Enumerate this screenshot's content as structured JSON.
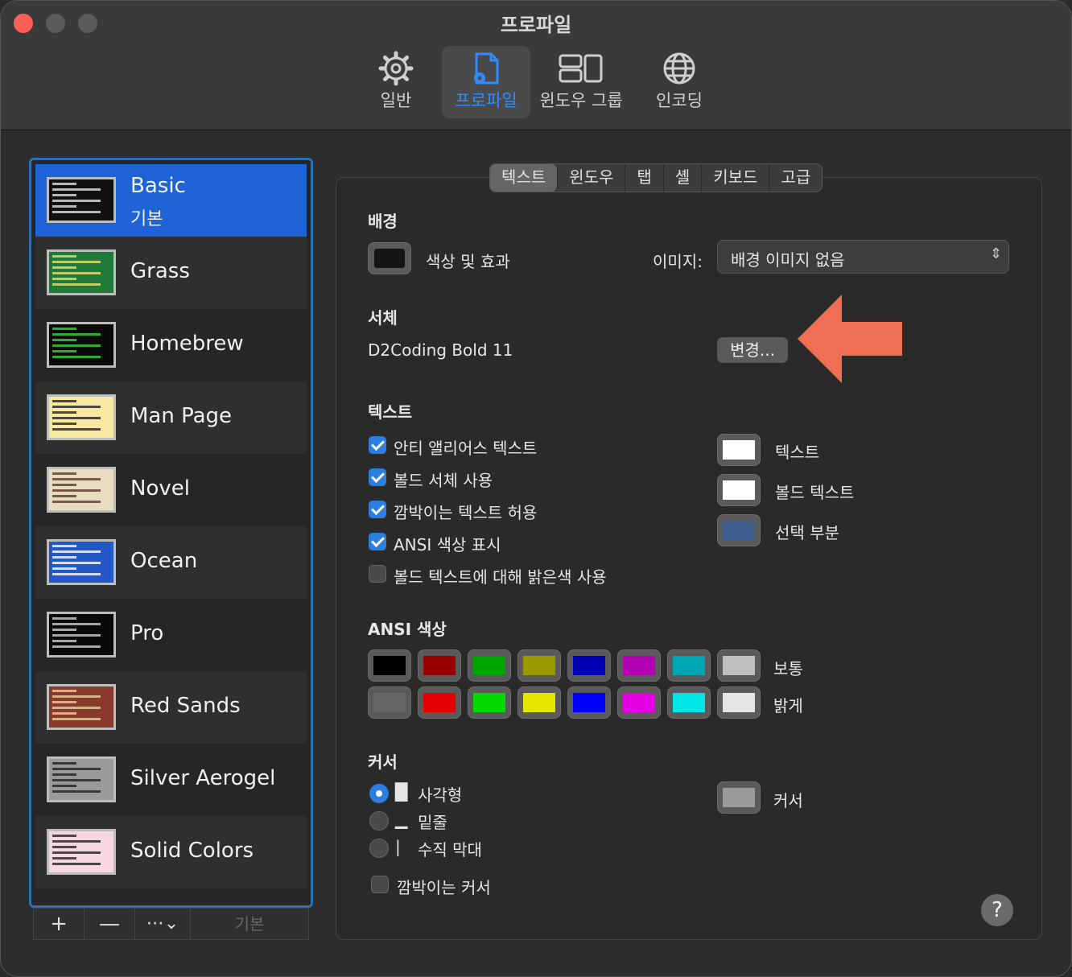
{
  "window": {
    "title": "프로파일"
  },
  "toolbar": {
    "items": [
      {
        "label": "일반",
        "icon": "gear-icon"
      },
      {
        "label": "프로파일",
        "icon": "profile-document-icon"
      },
      {
        "label": "윈도우 그룹",
        "icon": "window-group-icon"
      },
      {
        "label": "인코딩",
        "icon": "globe-icon"
      }
    ],
    "active_index": 1
  },
  "profiles": [
    {
      "name": "Basic",
      "subtitle": "기본",
      "bg": "#111111",
      "fg": "#e0e0e0"
    },
    {
      "name": "Grass",
      "bg": "#1f7a3a",
      "fg": "#e8e070"
    },
    {
      "name": "Homebrew",
      "bg": "#0a0a0a",
      "fg": "#3cd23c"
    },
    {
      "name": "Man Page",
      "bg": "#f7e9a0",
      "fg": "#222222"
    },
    {
      "name": "Novel",
      "bg": "#e8dcc0",
      "fg": "#5a3a2a"
    },
    {
      "name": "Ocean",
      "bg": "#2458c8",
      "fg": "#ffffff"
    },
    {
      "name": "Pro",
      "bg": "#0a0a0a",
      "fg": "#cccccc"
    },
    {
      "name": "Red Sands",
      "bg": "#8a3a2a",
      "fg": "#e8d0a0"
    },
    {
      "name": "Silver Aerogel",
      "bg": "#9a9a9a",
      "fg": "#222222"
    },
    {
      "name": "Solid Colors",
      "bg": "#f6d6e0",
      "fg": "#222222"
    }
  ],
  "list_buttons": {
    "add": "+",
    "remove": "—",
    "more": "⋯⌄",
    "default": "기본"
  },
  "tabs": [
    "텍스트",
    "윈도우",
    "탭",
    "셸",
    "키보드",
    "고급"
  ],
  "background": {
    "heading": "배경",
    "color_effects_label": "색상 및 효과",
    "image_label": "이미지:",
    "image_value": "배경 이미지 없음"
  },
  "font": {
    "heading": "서체",
    "value": "D2Coding Bold 11",
    "change_button": "변경..."
  },
  "text": {
    "heading": "텍스트",
    "options": [
      {
        "label": "안티 앨리어스 텍스트",
        "checked": true
      },
      {
        "label": "볼드 서체 사용",
        "checked": true
      },
      {
        "label": "깜박이는 텍스트 허용",
        "checked": true
      },
      {
        "label": "ANSI 색상 표시",
        "checked": true
      },
      {
        "label": "볼드 텍스트에 대해 밝은색 사용",
        "checked": false
      }
    ],
    "colors": [
      {
        "label": "텍스트",
        "color": "#ffffff"
      },
      {
        "label": "볼드 텍스트",
        "color": "#ffffff"
      },
      {
        "label": "선택 부분",
        "color": "#3f5f8f"
      }
    ]
  },
  "ansi": {
    "heading": "ANSI 색상",
    "normal_label": "보통",
    "bright_label": "밝게",
    "normal": [
      "#000000",
      "#990000",
      "#00a600",
      "#999900",
      "#0000b2",
      "#b200b2",
      "#00a6b2",
      "#bfbfbf"
    ],
    "bright": [
      "#666666",
      "#e50000",
      "#00d900",
      "#e5e500",
      "#0000ff",
      "#e500e5",
      "#00e5e5",
      "#e5e5e5"
    ]
  },
  "cursor": {
    "heading": "커서",
    "options": [
      {
        "glyph": "█",
        "label": "사각형",
        "selected": true
      },
      {
        "glyph": "▁",
        "label": "밑줄",
        "selected": false
      },
      {
        "glyph": "|",
        "label": "수직 막대",
        "selected": false
      }
    ],
    "blink_label": "깜박이는 커서",
    "blink_checked": false,
    "color_label": "커서",
    "color": "#9a9a9a"
  },
  "help": "?",
  "annotation": {
    "arrow_color": "#ef6f53"
  }
}
